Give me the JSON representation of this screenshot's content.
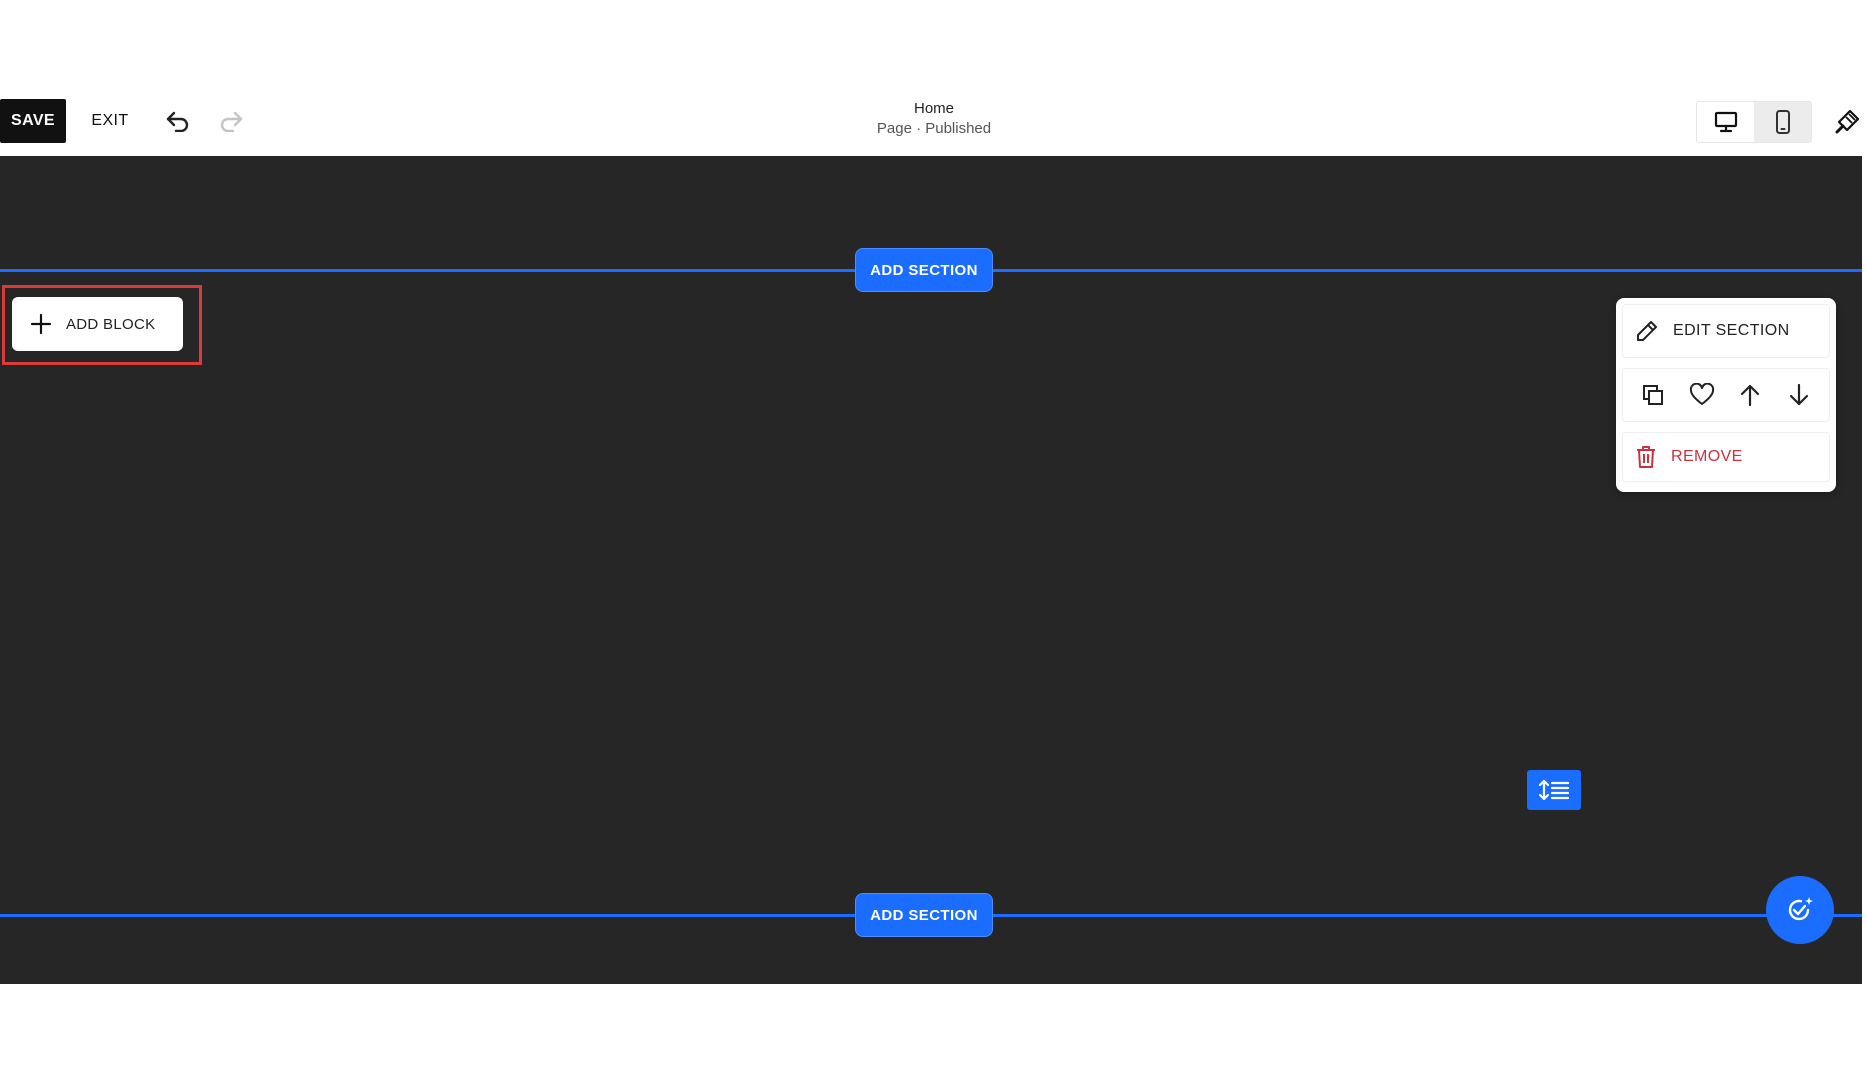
{
  "toolbar": {
    "save_label": "SAVE",
    "exit_label": "EXIT",
    "page_title": "Home",
    "page_status": "Page · Published"
  },
  "canvas": {
    "add_section_label": "ADD SECTION",
    "add_block_label": "ADD BLOCK"
  },
  "section_menu": {
    "edit_label": "EDIT SECTION",
    "remove_label": "REMOVE"
  },
  "colors": {
    "accent": "#1a6dff",
    "canvas_bg": "#262626",
    "danger": "#c8323c",
    "highlight": "#d93a3a"
  },
  "icons": [
    "undo-icon",
    "redo-icon",
    "desktop-icon",
    "mobile-icon",
    "paintbrush-icon",
    "plus-icon",
    "pencil-icon",
    "duplicate-icon",
    "heart-icon",
    "arrow-up-icon",
    "arrow-down-icon",
    "trash-icon",
    "spacing-icon",
    "sparkle-check-icon"
  ]
}
